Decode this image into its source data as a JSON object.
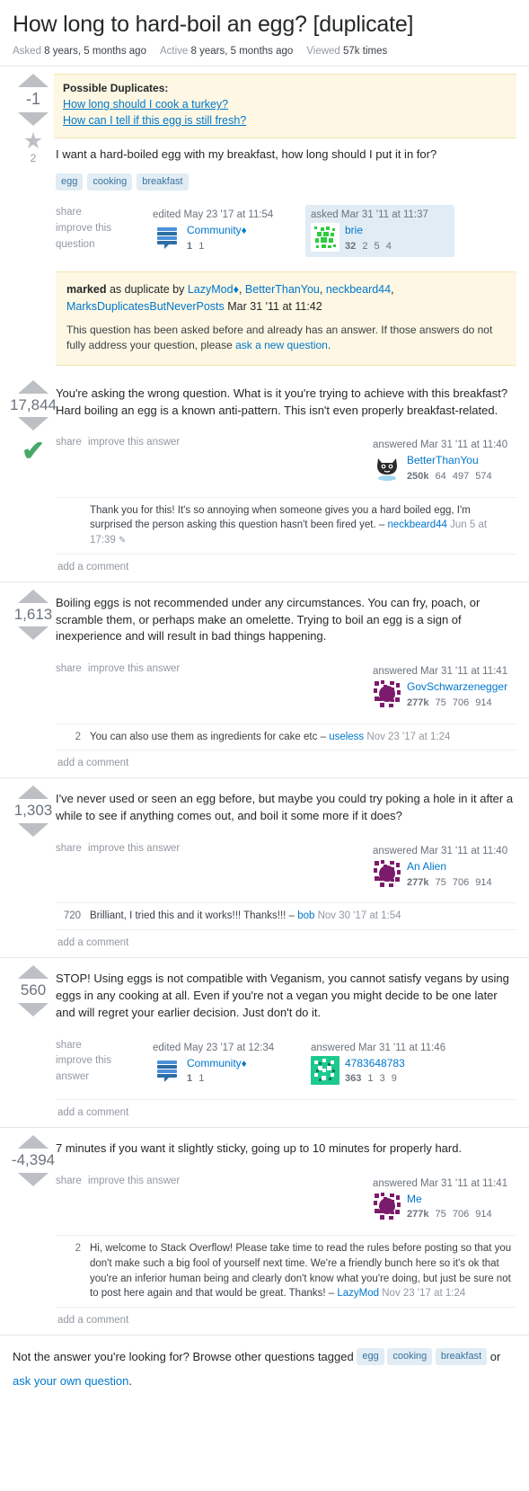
{
  "question": {
    "title": "How long to hard-boil an egg? [duplicate]",
    "stats": [
      {
        "label": "Asked",
        "value": "8 years, 5 months ago"
      },
      {
        "label": "Active",
        "value": "8 years, 5 months ago"
      },
      {
        "label": "Viewed",
        "value": "57k times"
      }
    ],
    "score": "-1",
    "favorites": "2",
    "duplicates_title": "Possible Duplicates:",
    "duplicates": [
      "How long should I cook a turkey?",
      "How can I tell if this egg is still fresh?"
    ],
    "body": "I want a hard-boiled egg with my breakfast, how long should I put it in for?",
    "tags": [
      "egg",
      "cooking",
      "breakfast"
    ],
    "actions": [
      "share",
      "improve this",
      "question"
    ],
    "editor": {
      "when": "edited May 23 '17 at 11:54",
      "name": "Community",
      "diamond": "♦",
      "rep": "1",
      "badge_silver": "1",
      "avatar": "community-avatar"
    },
    "author": {
      "when": "asked Mar 31 '11 at 11:37",
      "name": "brie",
      "rep": "32",
      "gold": "2",
      "silver": "5",
      "bronze": "4",
      "avatar": "brie-avatar"
    }
  },
  "marked": {
    "prefix": "marked",
    "text_mid": "as duplicate by",
    "users": [
      "LazyMod",
      "BetterThanYou",
      "neckbeard44",
      "MarksDuplicatesButNeverPosts"
    ],
    "diamond": "♦",
    "when": "Mar 31 '11 at 11:42",
    "explanation_before": "This question has been asked before and already has an answer. If those answers do not fully address your question, please ",
    "explanation_link": "ask a new question",
    "explanation_after": "."
  },
  "answers": [
    {
      "score": "17,844",
      "accepted": true,
      "accepted_icon": "✔",
      "body": "You're asking the wrong question. What is it you're trying to achieve with this breakfast? Hard boiling an egg is a known anti-pattern. This isn't even properly breakfast-related.",
      "actions": [
        "share",
        "improve this answer"
      ],
      "editor": null,
      "author": {
        "when": "answered Mar 31 '11 at 11:40",
        "name": "BetterThanYou",
        "rep": "250k",
        "gold": "64",
        "silver": "497",
        "bronze": "574",
        "avatar": "octocat-avatar"
      },
      "comments": [
        {
          "score": "",
          "text": "Thank you for this! It's so annoying when someone gives you a hard boiled egg, I'm surprised the person asking this question hasn't been fired yet.",
          "dash": "–",
          "user": "neckbeard44",
          "when": "Jun 5 at 17:39",
          "pencil": "✎"
        }
      ],
      "add_comment": "add a comment"
    },
    {
      "score": "1,613",
      "accepted": false,
      "body": "Boiling eggs is not recommended under any circumstances. You can fry, poach, or scramble them, or perhaps make an omelette. Trying to boil an egg is a sign of inexperience and will result in bad things happening.",
      "actions": [
        "share",
        "improve this answer"
      ],
      "editor": null,
      "author": {
        "when": "answered Mar 31 '11 at 11:41",
        "name": "GovSchwarzenegger",
        "rep": "277k",
        "gold": "75",
        "silver": "706",
        "bronze": "914",
        "avatar": "purple-identicon"
      },
      "comments": [
        {
          "score": "2",
          "text": "You can also use them as ingredients for cake etc",
          "dash": "–",
          "user": "useless",
          "when": "Nov 23 '17 at 1:24",
          "pencil": ""
        }
      ],
      "add_comment": "add a comment"
    },
    {
      "score": "1,303",
      "accepted": false,
      "body": "I've never used or seen an egg before, but maybe you could try poking a hole in it after a while to see if anything comes out, and boil it some more if it does?",
      "actions": [
        "share",
        "improve this answer"
      ],
      "editor": null,
      "author": {
        "when": "answered Mar 31 '11 at 11:40",
        "name": "An Alien",
        "rep": "277k",
        "gold": "75",
        "silver": "706",
        "bronze": "914",
        "avatar": "purple-identicon"
      },
      "comments": [
        {
          "score": "720",
          "text": "Brilliant, I tried this and it works!!! Thanks!!!",
          "dash": "–",
          "user": "bob",
          "when": "Nov 30 '17 at 1:54",
          "pencil": ""
        }
      ],
      "add_comment": "add a comment"
    },
    {
      "score": "560",
      "accepted": false,
      "body": "STOP! Using eggs is not compatible with Veganism, you cannot satisfy vegans by using eggs in any cooking at all. Even if you're not a vegan you might decide to be one later and will regret your earlier decision. Just don't do it.",
      "actions": [
        "share",
        "improve this",
        "answer"
      ],
      "editor": {
        "when": "edited May 23 '17 at 12:34",
        "name": "Community",
        "diamond": "♦",
        "rep": "1",
        "badge_silver": "1",
        "avatar": "community-avatar"
      },
      "author": {
        "when": "answered Mar 31 '11 at 11:46",
        "name": "4783648783",
        "rep": "363",
        "gold": "1",
        "silver": "3",
        "bronze": "9",
        "avatar": "green-identicon"
      },
      "comments": [],
      "add_comment": "add a comment"
    },
    {
      "score": "-4,394",
      "accepted": false,
      "body": "7 minutes if you want it slightly sticky, going up to 10 minutes for properly hard.",
      "actions": [
        "share",
        "improve this answer"
      ],
      "editor": null,
      "author": {
        "when": "answered Mar 31 '11 at 11:41",
        "name": "Me",
        "rep": "277k",
        "gold": "75",
        "silver": "706",
        "bronze": "914",
        "avatar": "purple-identicon"
      },
      "comments": [
        {
          "score": "2",
          "text": "Hi, welcome to Stack Overflow! Please take time to read the rules before posting so that you don't make such a big fool of yourself next time. We're a friendly bunch here so it's ok that you're an inferior human being and clearly don't know what you're doing, but just be sure not to post here again and that would be great. Thanks!",
          "dash": "–",
          "user": "LazyMod",
          "when": "Nov 23 '17 at 1:24",
          "pencil": ""
        }
      ],
      "add_comment": "add a comment"
    }
  ],
  "footer": {
    "prompt": "Not the answer you're looking for? Browse other questions tagged",
    "tags": [
      "egg",
      "cooking",
      "breakfast"
    ],
    "or": "or",
    "ask_link": "ask your own question",
    "period": "."
  },
  "colors": {
    "link": "#0077cc",
    "tag_bg": "#e1ecf4",
    "tag_fg": "#39739d",
    "accepted_green": "#48a868",
    "notice_bg": "#fdf7e3",
    "arrow_gray": "#bcc0c4"
  }
}
